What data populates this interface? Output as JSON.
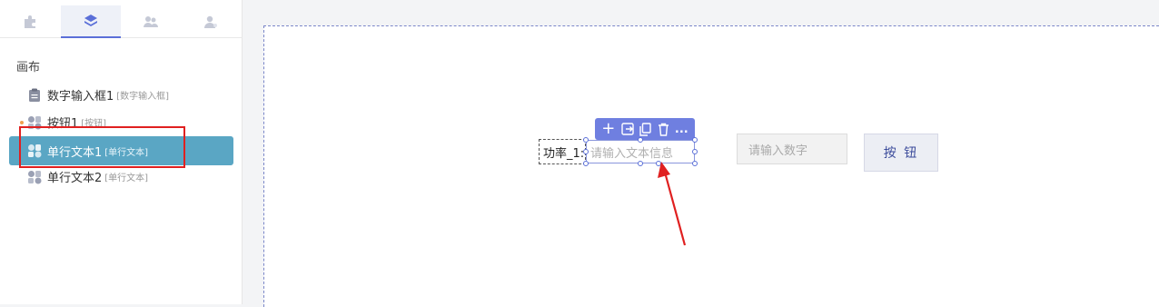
{
  "sidebar": {
    "tabs": [
      {
        "icon": "puzzle-icon",
        "active": false
      },
      {
        "icon": "layers-icon",
        "active": true
      },
      {
        "icon": "users-icon",
        "active": false
      },
      {
        "icon": "user-settings-icon",
        "active": false
      }
    ],
    "root_label": "画布",
    "items": [
      {
        "label": "数字输入框1",
        "type": "[数字输入框]",
        "icon": "clipboard-icon",
        "selected": false
      },
      {
        "label": "按钮1",
        "type": "[按钮]",
        "icon": "component-icon",
        "selected": false
      },
      {
        "label": "单行文本1",
        "type": "[单行文本]",
        "icon": "component-icon",
        "selected": true
      },
      {
        "label": "单行文本2",
        "type": "[单行文本]",
        "icon": "component-icon",
        "selected": false
      }
    ]
  },
  "canvas": {
    "toolbar": {
      "add": "+",
      "more": "..."
    },
    "text_field": {
      "label": "功率_1:",
      "placeholder": "请输入文本信息"
    },
    "number_field": {
      "placeholder": "请输入数字"
    },
    "button": {
      "label": "按 钮"
    }
  },
  "colors": {
    "accent": "#6f7fe0",
    "selected_item": "#5aa6c4",
    "highlight_box": "#e02020",
    "arrow": "#e02020"
  }
}
